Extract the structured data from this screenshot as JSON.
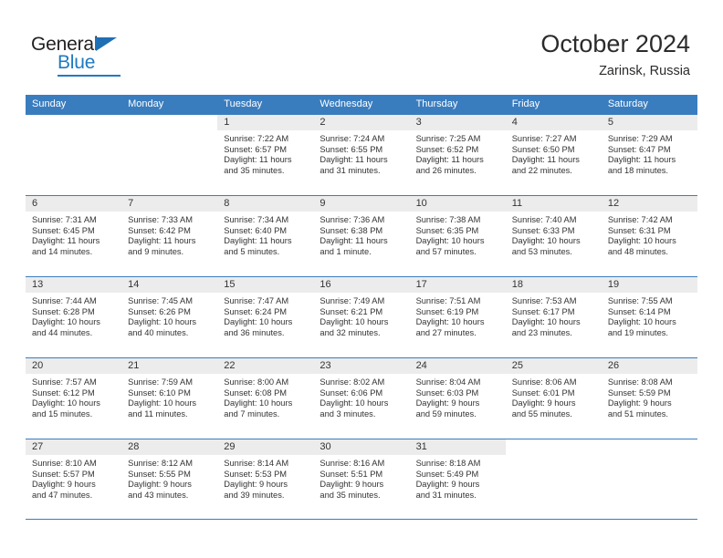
{
  "logo": {
    "word_top": "General",
    "word_bottom": "Blue",
    "accent_color": "#1f7ac0"
  },
  "header": {
    "title": "October 2024",
    "location": "Zarinsk, Russia"
  },
  "theme": {
    "header_blue": "#3a7dbf",
    "day_band_gray": "#ececec",
    "text": "#333333"
  },
  "weekdays": [
    "Sunday",
    "Monday",
    "Tuesday",
    "Wednesday",
    "Thursday",
    "Friday",
    "Saturday"
  ],
  "weeks": [
    [
      {
        "day": "",
        "sunrise": "",
        "sunset": "",
        "daylight1": "",
        "daylight2": ""
      },
      {
        "day": "",
        "sunrise": "",
        "sunset": "",
        "daylight1": "",
        "daylight2": ""
      },
      {
        "day": "1",
        "sunrise": "Sunrise: 7:22 AM",
        "sunset": "Sunset: 6:57 PM",
        "daylight1": "Daylight: 11 hours",
        "daylight2": "and 35 minutes."
      },
      {
        "day": "2",
        "sunrise": "Sunrise: 7:24 AM",
        "sunset": "Sunset: 6:55 PM",
        "daylight1": "Daylight: 11 hours",
        "daylight2": "and 31 minutes."
      },
      {
        "day": "3",
        "sunrise": "Sunrise: 7:25 AM",
        "sunset": "Sunset: 6:52 PM",
        "daylight1": "Daylight: 11 hours",
        "daylight2": "and 26 minutes."
      },
      {
        "day": "4",
        "sunrise": "Sunrise: 7:27 AM",
        "sunset": "Sunset: 6:50 PM",
        "daylight1": "Daylight: 11 hours",
        "daylight2": "and 22 minutes."
      },
      {
        "day": "5",
        "sunrise": "Sunrise: 7:29 AM",
        "sunset": "Sunset: 6:47 PM",
        "daylight1": "Daylight: 11 hours",
        "daylight2": "and 18 minutes."
      }
    ],
    [
      {
        "day": "6",
        "sunrise": "Sunrise: 7:31 AM",
        "sunset": "Sunset: 6:45 PM",
        "daylight1": "Daylight: 11 hours",
        "daylight2": "and 14 minutes."
      },
      {
        "day": "7",
        "sunrise": "Sunrise: 7:33 AM",
        "sunset": "Sunset: 6:42 PM",
        "daylight1": "Daylight: 11 hours",
        "daylight2": "and 9 minutes."
      },
      {
        "day": "8",
        "sunrise": "Sunrise: 7:34 AM",
        "sunset": "Sunset: 6:40 PM",
        "daylight1": "Daylight: 11 hours",
        "daylight2": "and 5 minutes."
      },
      {
        "day": "9",
        "sunrise": "Sunrise: 7:36 AM",
        "sunset": "Sunset: 6:38 PM",
        "daylight1": "Daylight: 11 hours",
        "daylight2": "and 1 minute."
      },
      {
        "day": "10",
        "sunrise": "Sunrise: 7:38 AM",
        "sunset": "Sunset: 6:35 PM",
        "daylight1": "Daylight: 10 hours",
        "daylight2": "and 57 minutes."
      },
      {
        "day": "11",
        "sunrise": "Sunrise: 7:40 AM",
        "sunset": "Sunset: 6:33 PM",
        "daylight1": "Daylight: 10 hours",
        "daylight2": "and 53 minutes."
      },
      {
        "day": "12",
        "sunrise": "Sunrise: 7:42 AM",
        "sunset": "Sunset: 6:31 PM",
        "daylight1": "Daylight: 10 hours",
        "daylight2": "and 48 minutes."
      }
    ],
    [
      {
        "day": "13",
        "sunrise": "Sunrise: 7:44 AM",
        "sunset": "Sunset: 6:28 PM",
        "daylight1": "Daylight: 10 hours",
        "daylight2": "and 44 minutes."
      },
      {
        "day": "14",
        "sunrise": "Sunrise: 7:45 AM",
        "sunset": "Sunset: 6:26 PM",
        "daylight1": "Daylight: 10 hours",
        "daylight2": "and 40 minutes."
      },
      {
        "day": "15",
        "sunrise": "Sunrise: 7:47 AM",
        "sunset": "Sunset: 6:24 PM",
        "daylight1": "Daylight: 10 hours",
        "daylight2": "and 36 minutes."
      },
      {
        "day": "16",
        "sunrise": "Sunrise: 7:49 AM",
        "sunset": "Sunset: 6:21 PM",
        "daylight1": "Daylight: 10 hours",
        "daylight2": "and 32 minutes."
      },
      {
        "day": "17",
        "sunrise": "Sunrise: 7:51 AM",
        "sunset": "Sunset: 6:19 PM",
        "daylight1": "Daylight: 10 hours",
        "daylight2": "and 27 minutes."
      },
      {
        "day": "18",
        "sunrise": "Sunrise: 7:53 AM",
        "sunset": "Sunset: 6:17 PM",
        "daylight1": "Daylight: 10 hours",
        "daylight2": "and 23 minutes."
      },
      {
        "day": "19",
        "sunrise": "Sunrise: 7:55 AM",
        "sunset": "Sunset: 6:14 PM",
        "daylight1": "Daylight: 10 hours",
        "daylight2": "and 19 minutes."
      }
    ],
    [
      {
        "day": "20",
        "sunrise": "Sunrise: 7:57 AM",
        "sunset": "Sunset: 6:12 PM",
        "daylight1": "Daylight: 10 hours",
        "daylight2": "and 15 minutes."
      },
      {
        "day": "21",
        "sunrise": "Sunrise: 7:59 AM",
        "sunset": "Sunset: 6:10 PM",
        "daylight1": "Daylight: 10 hours",
        "daylight2": "and 11 minutes."
      },
      {
        "day": "22",
        "sunrise": "Sunrise: 8:00 AM",
        "sunset": "Sunset: 6:08 PM",
        "daylight1": "Daylight: 10 hours",
        "daylight2": "and 7 minutes."
      },
      {
        "day": "23",
        "sunrise": "Sunrise: 8:02 AM",
        "sunset": "Sunset: 6:06 PM",
        "daylight1": "Daylight: 10 hours",
        "daylight2": "and 3 minutes."
      },
      {
        "day": "24",
        "sunrise": "Sunrise: 8:04 AM",
        "sunset": "Sunset: 6:03 PM",
        "daylight1": "Daylight: 9 hours",
        "daylight2": "and 59 minutes."
      },
      {
        "day": "25",
        "sunrise": "Sunrise: 8:06 AM",
        "sunset": "Sunset: 6:01 PM",
        "daylight1": "Daylight: 9 hours",
        "daylight2": "and 55 minutes."
      },
      {
        "day": "26",
        "sunrise": "Sunrise: 8:08 AM",
        "sunset": "Sunset: 5:59 PM",
        "daylight1": "Daylight: 9 hours",
        "daylight2": "and 51 minutes."
      }
    ],
    [
      {
        "day": "27",
        "sunrise": "Sunrise: 8:10 AM",
        "sunset": "Sunset: 5:57 PM",
        "daylight1": "Daylight: 9 hours",
        "daylight2": "and 47 minutes."
      },
      {
        "day": "28",
        "sunrise": "Sunrise: 8:12 AM",
        "sunset": "Sunset: 5:55 PM",
        "daylight1": "Daylight: 9 hours",
        "daylight2": "and 43 minutes."
      },
      {
        "day": "29",
        "sunrise": "Sunrise: 8:14 AM",
        "sunset": "Sunset: 5:53 PM",
        "daylight1": "Daylight: 9 hours",
        "daylight2": "and 39 minutes."
      },
      {
        "day": "30",
        "sunrise": "Sunrise: 8:16 AM",
        "sunset": "Sunset: 5:51 PM",
        "daylight1": "Daylight: 9 hours",
        "daylight2": "and 35 minutes."
      },
      {
        "day": "31",
        "sunrise": "Sunrise: 8:18 AM",
        "sunset": "Sunset: 5:49 PM",
        "daylight1": "Daylight: 9 hours",
        "daylight2": "and 31 minutes."
      },
      {
        "day": "",
        "sunrise": "",
        "sunset": "",
        "daylight1": "",
        "daylight2": ""
      },
      {
        "day": "",
        "sunrise": "",
        "sunset": "",
        "daylight1": "",
        "daylight2": ""
      }
    ]
  ]
}
